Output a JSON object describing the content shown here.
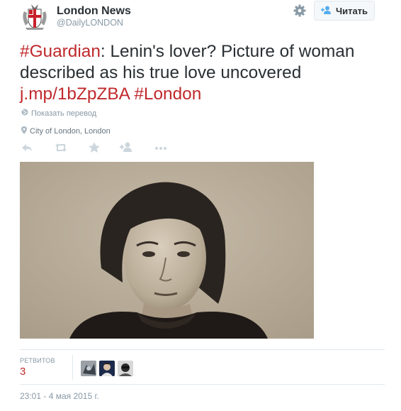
{
  "account": {
    "name": "London News",
    "handle": "@DailyLONDON"
  },
  "follow_button": {
    "label": "Читать",
    "icon": "add-user-icon"
  },
  "settings_icon": "gear-icon",
  "tweet": {
    "hashtag_source": "#Guardian",
    "text_main": ": Lenin's lover? Picture of woman described as his true love uncovered ",
    "link": "j.mp/1bZpZBA",
    "hashtag_city": "#London"
  },
  "translate": {
    "label": "Показать перевод",
    "icon": "globe-icon"
  },
  "location": {
    "label": "City of London, London",
    "icon": "map-pin-icon"
  },
  "actions": [
    "reply-icon",
    "retweet-icon",
    "favorite-icon",
    "follow-icon",
    "more-icon"
  ],
  "stats": {
    "retweets_label": "РЕТВИТОВ",
    "retweets_count": "3"
  },
  "timestamp": "23:01 - 4 мая 2015 г.",
  "colors": {
    "link": "#c0292c",
    "text": "#292f33",
    "muted": "#8899a6",
    "border": "#e1e8ed"
  }
}
